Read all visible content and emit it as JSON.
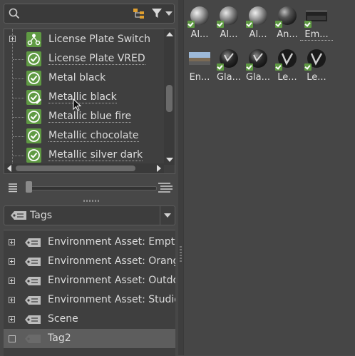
{
  "search": {
    "placeholder": "",
    "value": ""
  },
  "materials": {
    "items": [
      {
        "label": "License Plate Switch",
        "icon": "material-switch-icon",
        "expandable": true
      },
      {
        "label": "License Plate VRED",
        "icon": "material-icon",
        "expandable": false
      },
      {
        "label": "Metal black",
        "icon": "material-icon",
        "expandable": false
      },
      {
        "label": "Metallic black",
        "icon": "material-icon-edit",
        "expandable": false
      },
      {
        "label": "Metallic blue fire",
        "icon": "material-icon",
        "expandable": false
      },
      {
        "label": "Metallic chocolate",
        "icon": "material-icon",
        "expandable": false
      },
      {
        "label": "Metallic silver dark",
        "icon": "material-icon",
        "expandable": false
      }
    ]
  },
  "tags_selector": {
    "label": "Tags"
  },
  "tags": {
    "items": [
      {
        "label": "Environment Asset: Empty_",
        "expandable": true
      },
      {
        "label": "Environment Asset: Orange",
        "expandable": true
      },
      {
        "label": "Environment Asset: Outdoo",
        "expandable": true
      },
      {
        "label": "Environment Asset: Studio",
        "expandable": true
      },
      {
        "label": "Scene",
        "expandable": true
      },
      {
        "label": "Tag2",
        "expandable": false,
        "selected": true
      }
    ]
  },
  "assets": {
    "row1": [
      {
        "caption": "Al...",
        "kind": "sphere-chrome"
      },
      {
        "caption": "Al...",
        "kind": "sphere-chrome"
      },
      {
        "caption": "Al...",
        "kind": "sphere-chrome"
      },
      {
        "caption": "An...",
        "kind": "sphere-dark"
      },
      {
        "caption": "Em...",
        "kind": "env-empty"
      }
    ],
    "row2": [
      {
        "caption": "En...",
        "kind": "env-outdoor"
      },
      {
        "caption": "Gla...",
        "kind": "sphere-glass"
      },
      {
        "caption": "Gla...",
        "kind": "sphere-glass"
      },
      {
        "caption": "Le...",
        "kind": "sphere-leather"
      },
      {
        "caption": "Le...",
        "kind": "sphere-leather"
      }
    ]
  },
  "colors": {
    "material_green": "#5f9a43",
    "panel_bg": "#474747",
    "selection": "#5d5d5d"
  }
}
